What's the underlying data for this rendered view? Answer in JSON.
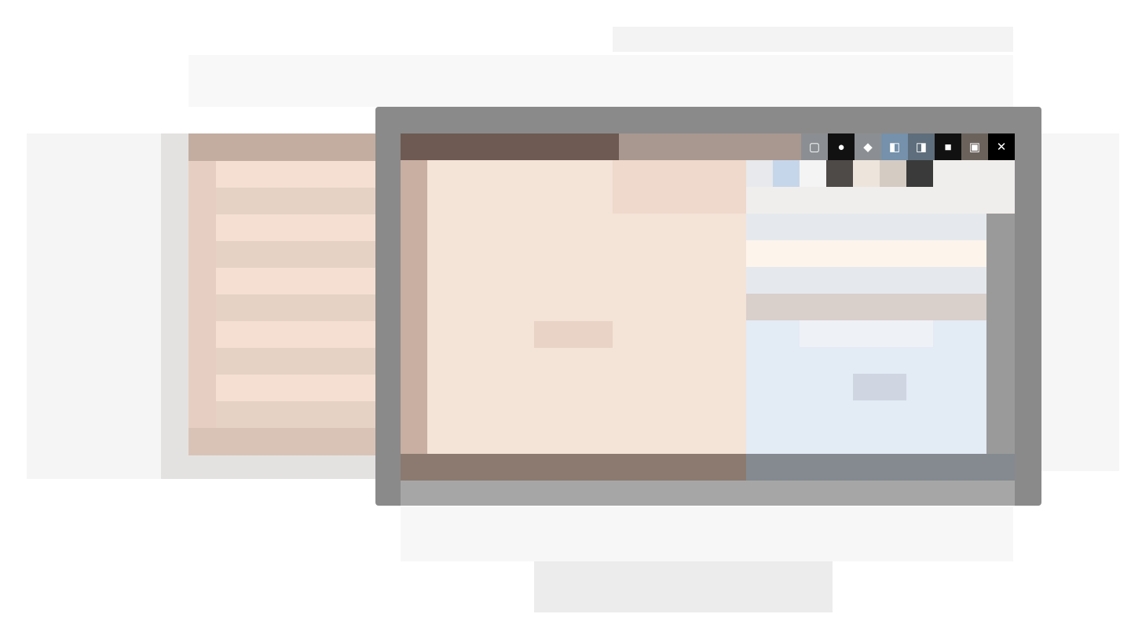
{
  "colors": {
    "frame": "#8a8a8a",
    "titlebar": "#6e5a52",
    "canvas": "#f4e3d7",
    "dialog_panel": "#e3ebf5",
    "accent_blue": "#7591ab"
  },
  "app": {
    "title": "",
    "canvas_label": "",
    "status": ""
  },
  "toolbar": {
    "icons": [
      "toolbar-icon-1",
      "toolbar-icon-2",
      "toolbar-icon-3",
      "toolbar-icon-4",
      "toolbar-icon-5",
      "toolbar-icon-6",
      "toolbar-icon-7"
    ]
  },
  "dialog": {
    "panel_title": ""
  },
  "left_panel": {
    "items": [
      "",
      "",
      "",
      "",
      "",
      "",
      "",
      "",
      "",
      ""
    ]
  }
}
